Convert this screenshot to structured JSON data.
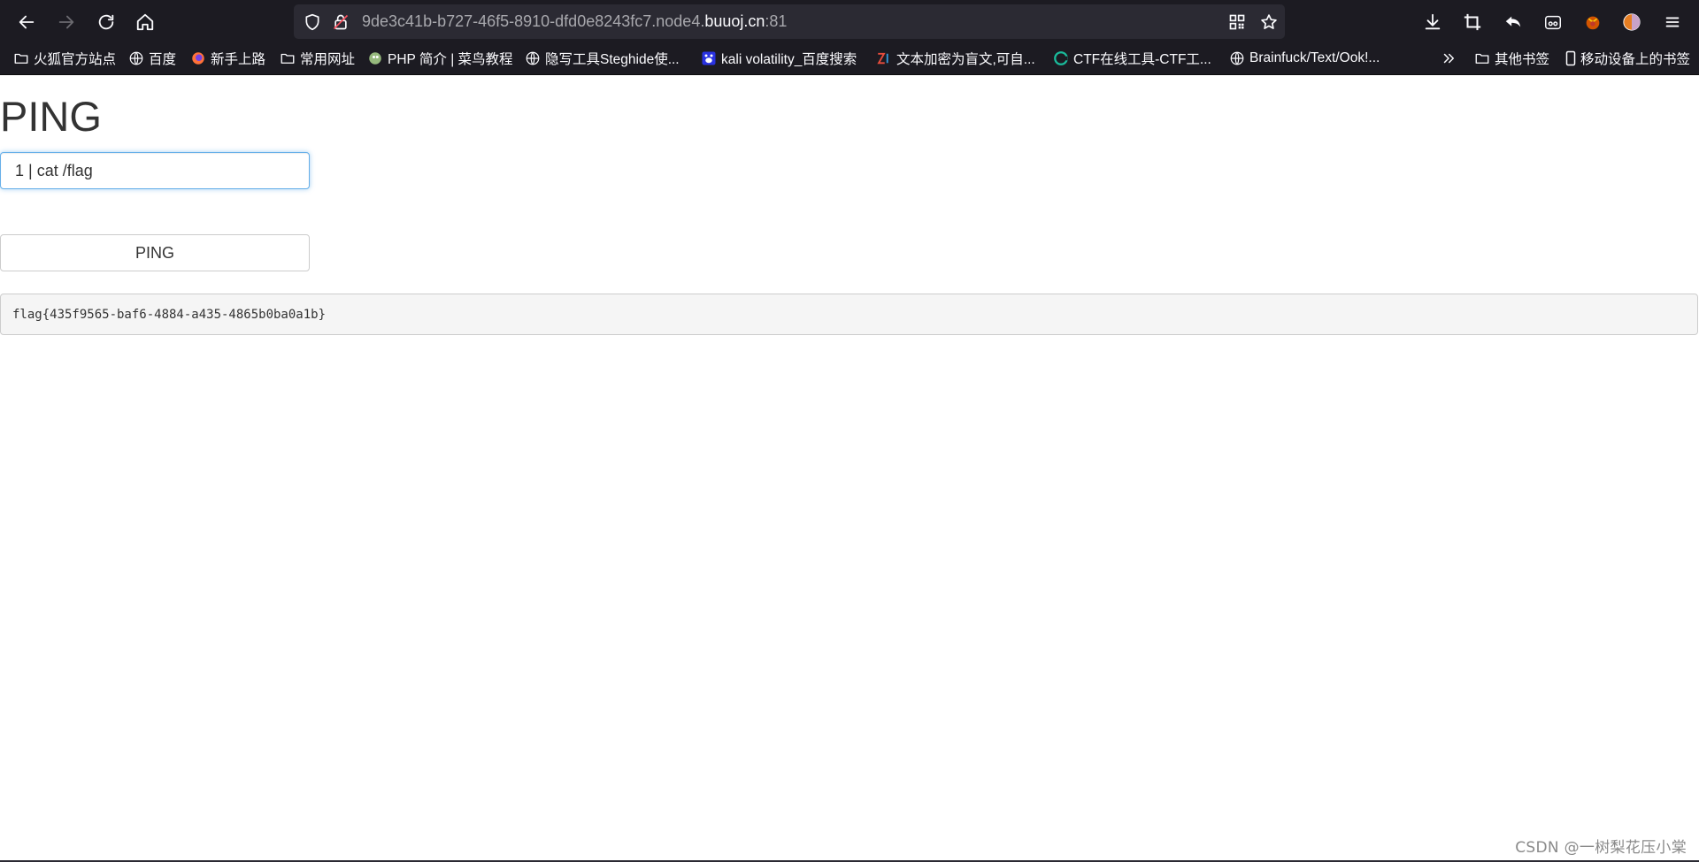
{
  "browser": {
    "url_prefix": "9de3c41b-b727-46f5-8910-dfd0e8243fc7.node4.",
    "url_host": "buuoj.cn",
    "url_port": ":81"
  },
  "bookmarks": [
    {
      "label": "火狐官方站点",
      "icon": "folder-icon"
    },
    {
      "label": "百度",
      "icon": "globe-icon"
    },
    {
      "label": "新手上路",
      "icon": "firefox-icon"
    },
    {
      "label": "常用网址",
      "icon": "folder-icon"
    },
    {
      "label": "PHP 简介 | 菜鸟教程",
      "icon": "runoob-icon"
    },
    {
      "label": "隐写工具Steghide使...",
      "icon": "globe-icon"
    },
    {
      "label": "kali volatility_百度搜索",
      "icon": "baidu-paw-icon"
    },
    {
      "label": "文本加密为盲文,可自...",
      "icon": "zi-icon"
    },
    {
      "label": "CTF在线工具-CTF工...",
      "icon": "ctf-icon"
    },
    {
      "label": "Brainfuck/Text/Ook!...",
      "icon": "globe-icon"
    }
  ],
  "bookmarks_overflow": {
    "other_label": "其他书签",
    "mobile_label": "移动设备上的书签"
  },
  "page": {
    "title": "PING",
    "input_value": "1 | cat /flag",
    "button_label": "PING",
    "result": "flag{435f9565-baf6-4884-a435-4865b0ba0a1b}"
  },
  "watermark": "CSDN @一树梨花压小棠",
  "colors": {
    "chrome_bg": "#1c1b22",
    "urlbar_bg": "#2b2a33",
    "focus_border": "#66afe9",
    "result_bg": "#f5f5f5"
  }
}
